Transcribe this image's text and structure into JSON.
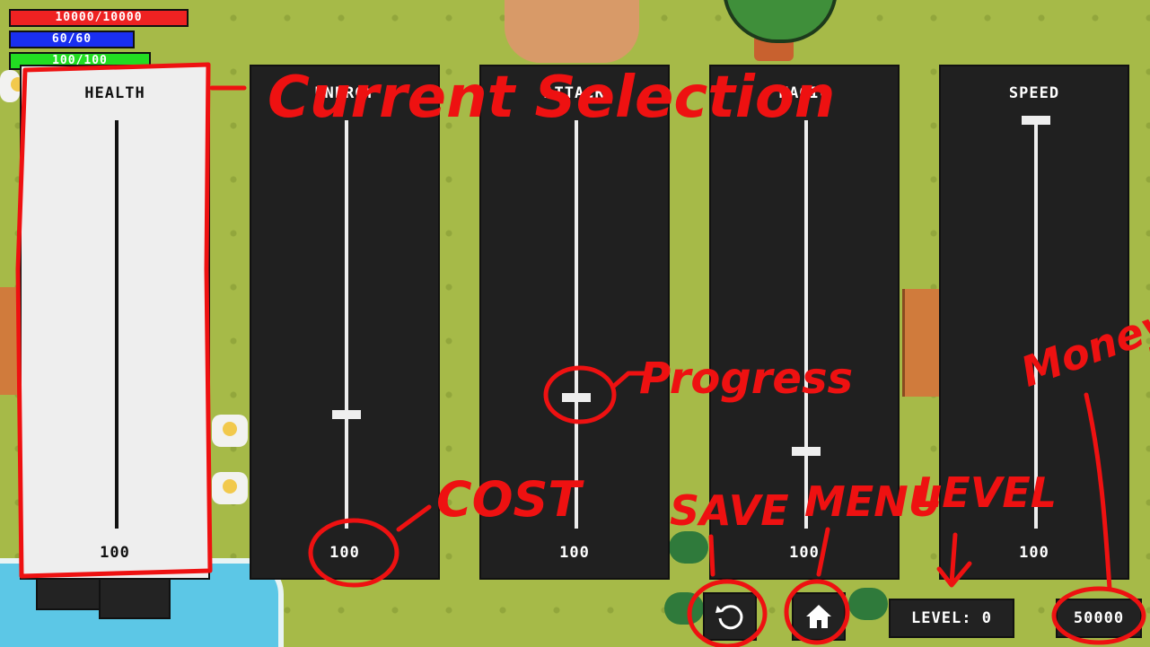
{
  "hud": {
    "health_text": "10000/10000",
    "mana_text": "60/60",
    "stamina_text": "100/100",
    "health_level": 1.0,
    "mana_level": 1.0,
    "stamina_level": 1.0,
    "health_color": "#ee2222",
    "mana_color": "#1a2ff0",
    "stamina_color": "#22dd22"
  },
  "upgrades": [
    {
      "title": "HEALTH",
      "cost": "100",
      "progress": 1.0,
      "selected": true
    },
    {
      "title": "ENERGY",
      "cost": "100",
      "progress": 0.28,
      "selected": false
    },
    {
      "title": "ATTACK",
      "cost": "100",
      "progress": 0.32,
      "selected": false
    },
    {
      "title": "MAGIC",
      "cost": "100",
      "progress": 0.19,
      "selected": false
    },
    {
      "title": "SPEED",
      "cost": "100",
      "progress": 1.0,
      "selected": false
    }
  ],
  "footer": {
    "level_text": "LEVEL: 0",
    "money_text": "50000",
    "save_icon": "rotate-icon",
    "menu_icon": "home-icon"
  },
  "annotations": {
    "current_selection": "Current Selection",
    "progress": "Progress",
    "cost": "COST",
    "save": "SAVE",
    "menu": "MENU",
    "level": "LEVEL",
    "money": "Money",
    "ink_color": "#ee1111"
  }
}
